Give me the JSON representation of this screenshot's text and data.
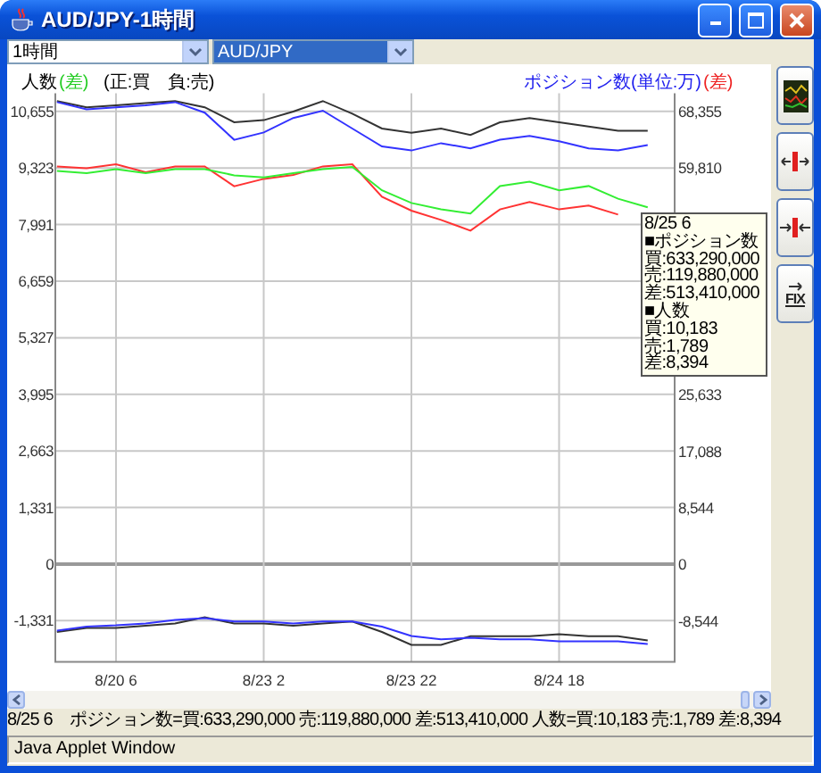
{
  "window": {
    "title": "AUD/JPY-1時間"
  },
  "selectors": [
    {
      "value": "1時間",
      "selected": false
    },
    {
      "value": "AUD/JPY",
      "selected": true
    }
  ],
  "legend": {
    "left_label": "人数",
    "left_diff": {
      "text": "(差)",
      "color": "#22cc22"
    },
    "sign_note": "(正:買　負:売)",
    "right_label": "ポジション数(単位:万)",
    "right_diff": {
      "text": "(差)",
      "color": "#ee2222"
    }
  },
  "chart": {
    "chart_data": {
      "type": "line",
      "grid": true,
      "categories": [
        null,
        null,
        "8/20 6",
        null,
        null,
        null,
        null,
        "8/23 2",
        null,
        null,
        null,
        null,
        "8/23 22",
        null,
        null,
        null,
        null,
        "8/24 18",
        null,
        null,
        null
      ],
      "ylim": [
        -2300,
        11000
      ],
      "y2lim": [
        -14700,
        70600
      ],
      "yticks": [
        {
          "value": 10655,
          "label": "10,655"
        },
        {
          "value": 9323,
          "label": "9,323"
        },
        {
          "value": 7991,
          "label": "7,991"
        },
        {
          "value": 6659,
          "label": "6,659"
        },
        {
          "value": 5327,
          "label": "5,327"
        },
        {
          "value": 3995,
          "label": "3,995"
        },
        {
          "value": 2663,
          "label": "2,663"
        },
        {
          "value": 1331,
          "label": "1,331"
        },
        {
          "value": 0,
          "label": "0"
        },
        {
          "value": -1331,
          "label": "-1,331"
        }
      ],
      "y2ticks": [
        {
          "value": 68355,
          "label": "68,355"
        },
        {
          "value": 59810,
          "label": "59,810"
        },
        {
          "value": 25633,
          "label": "25,633"
        },
        {
          "value": 17088,
          "label": "17,088"
        },
        {
          "value": 8544,
          "label": "8,544"
        },
        {
          "value": 0,
          "label": "0"
        },
        {
          "value": -8544,
          "label": "-8,544"
        }
      ],
      "series": [
        {
          "color": "#333333",
          "values": [
            10900,
            10750,
            10800,
            10850,
            10900,
            10750,
            10400,
            10450,
            10650,
            10900,
            10600,
            10250,
            10150,
            10250,
            10100,
            10400,
            10500,
            10400,
            10300,
            10200,
            10200
          ]
        },
        {
          "color": "#3333ff",
          "axis": "y2",
          "values": [
            69800,
            68700,
            69000,
            69300,
            69800,
            68200,
            64100,
            65200,
            67400,
            68500,
            65800,
            63100,
            62500,
            63600,
            62800,
            64100,
            64700,
            63900,
            62800,
            62500,
            63300
          ]
        },
        {
          "color": "#ff3333",
          "axis": "y2",
          "values": [
            60100,
            59800,
            60400,
            59200,
            60100,
            60100,
            57100,
            58200,
            58800,
            60100,
            60400,
            55500,
            53400,
            52000,
            50400,
            53600,
            54700,
            53600,
            54200,
            52800,
            null
          ]
        },
        {
          "color": "#33ee33",
          "values": [
            9250,
            9200,
            9300,
            9200,
            9300,
            9300,
            9150,
            9100,
            9200,
            9300,
            9350,
            8800,
            8500,
            8350,
            8250,
            8900,
            9000,
            8800,
            8900,
            8600,
            8400
          ]
        },
        {
          "color": "#333333",
          "values": [
            -1600,
            -1500,
            -1500,
            -1450,
            -1400,
            -1250,
            -1400,
            -1400,
            -1450,
            -1400,
            -1350,
            -1600,
            -1900,
            -1900,
            -1700,
            -1700,
            -1700,
            -1650,
            -1700,
            -1700,
            -1800
          ]
        },
        {
          "color": "#3333ff",
          "axis": "y2",
          "values": [
            -10000,
            -9400,
            -9200,
            -8900,
            -8400,
            -8100,
            -8600,
            -8600,
            -8900,
            -8600,
            -8600,
            -9400,
            -10800,
            -11300,
            -11100,
            -11300,
            -11300,
            -11600,
            -11600,
            -11600,
            -12000
          ]
        }
      ]
    }
  },
  "tooltip": {
    "lines": [
      "8/25 6",
      "■ポジション数",
      "買:633,290,000",
      "売:119,880,000",
      "差:513,410,000",
      "■人数",
      "買:10,183",
      "売:1,789",
      "差:8,394"
    ]
  },
  "toolbar": [
    {
      "kind": "chart"
    },
    {
      "kind": "expand"
    },
    {
      "kind": "shrink"
    },
    {
      "kind": "fix",
      "label": "FIX"
    }
  ],
  "status": "8/25 6　ポジション数=買:633,290,000 売:119,880,000 差:513,410,000 人数=買:10,183 売:1,789 差:8,394",
  "applet_label": "Java Applet Window"
}
